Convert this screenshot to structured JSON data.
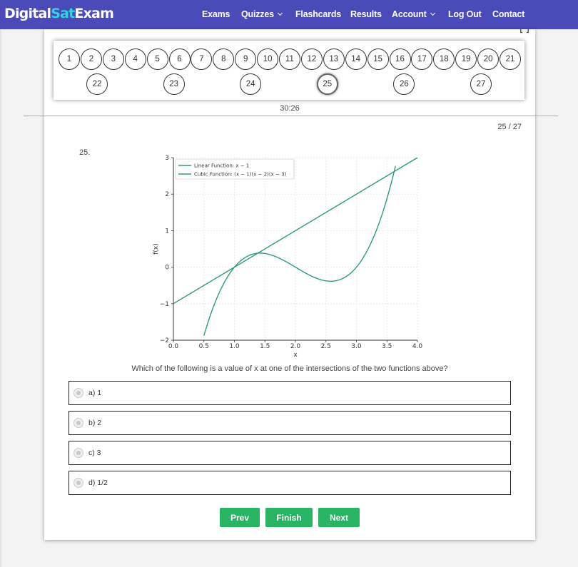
{
  "brand": {
    "part1": "Digital",
    "part2": "Sat",
    "part3": "Exam"
  },
  "nav": {
    "exams": "Exams",
    "quizzes": "Quizzes",
    "flashcards": "Flashcards",
    "results": "Results",
    "account": "Account",
    "logout": "Log Out",
    "contact": "Contact"
  },
  "questions": {
    "row1": [
      "1",
      "2",
      "3",
      "4",
      "5",
      "6",
      "7",
      "8",
      "9",
      "10",
      "11",
      "12",
      "13",
      "14",
      "15",
      "16",
      "17",
      "18",
      "19",
      "20",
      "21"
    ],
    "row2": [
      "22",
      "23",
      "24",
      "25",
      "26",
      "27"
    ],
    "active": "25"
  },
  "timer": "30:26",
  "counter": "25 / 27",
  "question_number": "25.",
  "question_text": "Which of the following is a value of x at one of the intersections of the two functions above?",
  "options": [
    {
      "label": "a) 1"
    },
    {
      "label": "b) 2"
    },
    {
      "label": "c) 3"
    },
    {
      "label": "d) 1/2"
    }
  ],
  "buttons": {
    "prev": "Prev",
    "finish": "Finish",
    "next": "Next"
  },
  "colors": {
    "nav": "#4a4ab8",
    "accent": "#34d3e2",
    "button": "#28b463",
    "series": "#2e9e72"
  },
  "chart_data": {
    "type": "line",
    "xlabel": "x",
    "ylabel": "f(x)",
    "xlim": [
      0,
      4
    ],
    "ylim": [
      -2,
      3
    ],
    "xticks": [
      "0.0",
      "0.5",
      "1.0",
      "1.5",
      "2.0",
      "2.5",
      "3.0",
      "3.5",
      "4.0"
    ],
    "yticks": [
      "−2",
      "−1",
      "0",
      "1",
      "2",
      "3"
    ],
    "grid": true,
    "legend": "top-left",
    "series": [
      {
        "name": "Linear Function: x − 1",
        "x": [
          0,
          4
        ],
        "y": [
          -1,
          3
        ]
      },
      {
        "name": "Cubic Function: (x − 1)(x − 2)(x − 3)",
        "x": [
          0.5,
          0.75,
          1.0,
          1.25,
          1.42,
          1.75,
          2.0,
          2.25,
          2.58,
          3.0,
          3.25,
          3.5,
          3.66
        ],
        "y": [
          -1.875,
          -0.703,
          0.0,
          0.328,
          0.385,
          0.234,
          0.0,
          -0.234,
          -0.385,
          0.0,
          0.703,
          1.875,
          2.9
        ]
      }
    ]
  }
}
